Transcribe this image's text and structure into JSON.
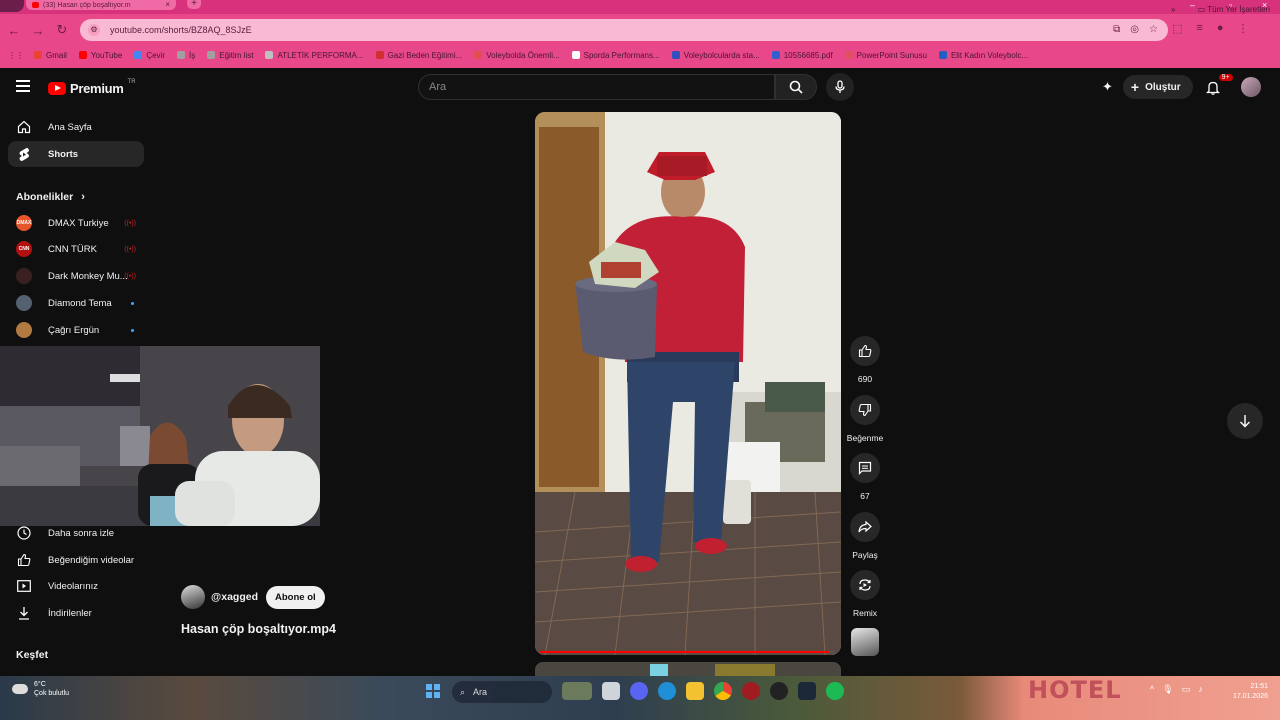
{
  "browser": {
    "tab_title": "(33) Hasan çöp boşaltıyor.m",
    "url": "youtube.com/shorts/BZ8AQ_8SJzE",
    "bookmarks": [
      "Gmail",
      "YouTube",
      "Çevir",
      "İş",
      "Eğitim list",
      "ATLETİK PERFORMA...",
      "Gazi Beden Eğitimi...",
      "Voleybolda Önemli...",
      "Sporda Performans...",
      "Voleybolcularda sta...",
      "10556685.pdf",
      "PowerPoint Sunusu",
      "Elit Kadın Voleybolc..."
    ],
    "bookmarks_overflow": "»",
    "all_bookmarks": "Tüm Yer İşaretleri"
  },
  "header": {
    "logo_text": "Premium",
    "logo_region": "TR",
    "search_placeholder": "Ara",
    "create_label": "Oluştur",
    "notif_badge": "9+"
  },
  "sidebar": {
    "nav": [
      {
        "label": "Ana Sayfa",
        "icon": "home-icon"
      },
      {
        "label": "Shorts",
        "icon": "shorts-icon"
      }
    ],
    "subscriptions_title": "Abonelikler",
    "subscriptions": [
      {
        "name": "DMAX Turkiye",
        "status": "live"
      },
      {
        "name": "CNN TÜRK",
        "status": "live"
      },
      {
        "name": "Dark Monkey Mu...",
        "status": "live"
      },
      {
        "name": "Diamond Tema",
        "status": "new"
      },
      {
        "name": "Çağrı Ergün",
        "status": "new"
      }
    ],
    "library": [
      {
        "label": "Daha sonra izle",
        "icon": "clock-icon"
      },
      {
        "label": "Beğendiğim videolar",
        "icon": "like-icon"
      },
      {
        "label": "Videolarınız",
        "icon": "video-icon"
      },
      {
        "label": "İndirilenler",
        "icon": "download-icon"
      }
    ],
    "explore_title": "Keşfet"
  },
  "short": {
    "channel": "@xagged",
    "subscribe_label": "Abone ol",
    "title": "Hasan çöp boşaltıyor.mp4",
    "progress": 0.98
  },
  "actions": {
    "likes": "690",
    "dislike_label": "Beğenme",
    "comments": "67",
    "share_label": "Paylaş",
    "remix_label": "Remix"
  },
  "taskbar": {
    "temperature": "6°C",
    "weather": "Çok bulutlu",
    "search_label": "Ara",
    "wallpaper_text": "HOTEL",
    "time": "21:51",
    "date": "17.01.2026"
  }
}
